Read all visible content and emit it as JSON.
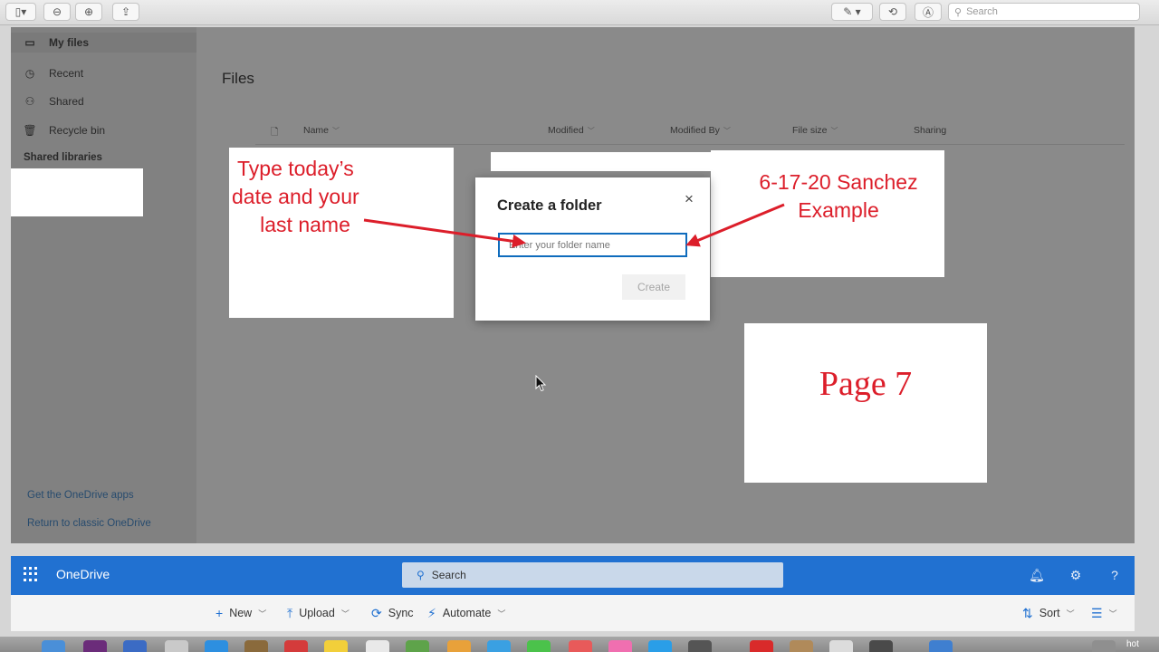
{
  "toolbar": {
    "search_placeholder": "Search"
  },
  "sidebar": {
    "items": [
      {
        "label": "My files",
        "icon": "folder-icon",
        "active": true
      },
      {
        "label": "Recent",
        "icon": "clock-icon"
      },
      {
        "label": "Shared",
        "icon": "people-icon"
      },
      {
        "label": "Recycle bin",
        "icon": "trash-icon"
      }
    ],
    "shared_libraries": "Shared libraries",
    "links": [
      "Get the OneDrive apps",
      "Return to classic OneDrive"
    ]
  },
  "main": {
    "title": "Files",
    "columns": [
      "Name",
      "Modified",
      "Modified By",
      "File size",
      "Sharing"
    ]
  },
  "dialog": {
    "title": "Create a folder",
    "input_placeholder": "Enter your folder name",
    "create_label": "Create",
    "close_label": "×"
  },
  "annotations": {
    "left_note": [
      "Type today’s",
      "date and your",
      "last name"
    ],
    "right_note": [
      "6-17-20 Sanchez",
      "Example"
    ],
    "page_label": "Page  7",
    "color": "#dc1e2a"
  },
  "app_bar": {
    "brand": "OneDrive",
    "search_label": "Search",
    "color": "#2171d1"
  },
  "command_bar": {
    "new_label": "New",
    "upload_label": "Upload",
    "sync_label": "Sync",
    "automate_label": "Automate",
    "sort_label": "Sort"
  },
  "dock": {
    "tail_text": "hot"
  }
}
